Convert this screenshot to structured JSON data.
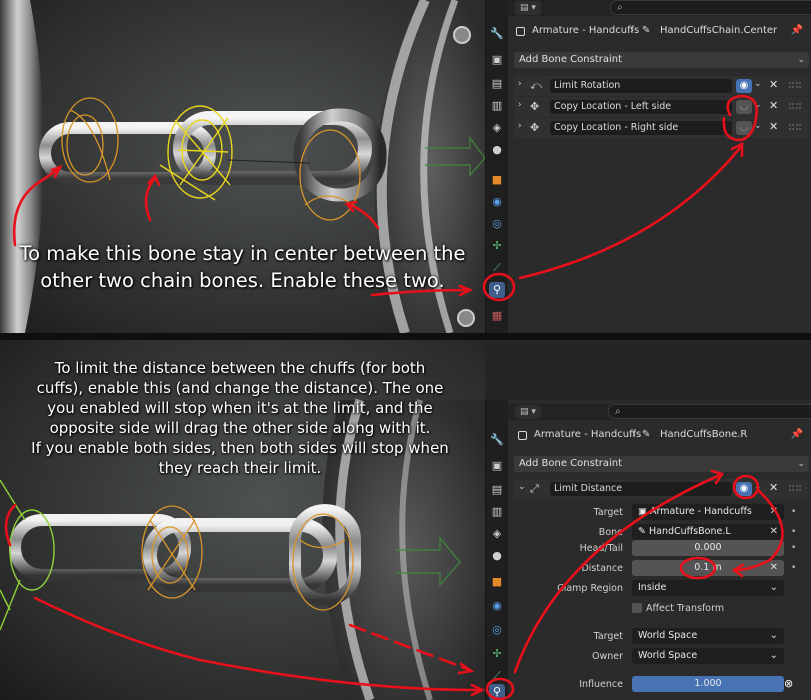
{
  "top": {
    "overlay_text_line1": "To make this bone stay in center between the",
    "overlay_text_line2": "other two chain bones. Enable these two.",
    "panel": {
      "search_placeholder": "",
      "breadcrumb_object": "Armature - Handcuffs",
      "breadcrumb_bone": "HandCuffsChain.Center",
      "add_bone_constraint": "Add Bone Constraint",
      "constraints": [
        {
          "name": "Limit Rotation",
          "enabled": true
        },
        {
          "name": "Copy Location - Left side",
          "enabled": false
        },
        {
          "name": "Copy Location - Right side",
          "enabled": false
        }
      ]
    }
  },
  "bottom": {
    "overlay_lines": [
      "To limit the distance between the chuffs (for both",
      "cuffs), enable this (and change the distance). The one",
      "you enabled will stop when it's at the limit, and the",
      "opposite side will drag the other side along with it.",
      "If you enable both sides, then both sides will stop when",
      "they reach their limit."
    ],
    "panel": {
      "breadcrumb_object": "Armature - Handcuffs",
      "breadcrumb_bone": "HandCuffsBone.R",
      "add_bone_constraint": "Add Bone Constraint",
      "constraint_name": "Limit Distance",
      "constraint_enabled": true,
      "target_label": "Target",
      "target_value": "Armature - Handcuffs",
      "bone_label": "Bone",
      "bone_value": "HandCuffsBone.L",
      "headtail_label": "Head/Tail",
      "headtail_value": "0.000",
      "distance_label": "Distance",
      "distance_value": "0.1 m",
      "clamp_label": "Clamp Region",
      "clamp_value": "Inside",
      "affect_transform_label": "Affect Transform",
      "target_space_label": "Target",
      "target_space_value": "World Space",
      "owner_space_label": "Owner",
      "owner_space_value": "World Space",
      "influence_label": "Influence",
      "influence_value": "1.000"
    }
  },
  "colors": {
    "annotation_red": "#e8101a",
    "blender_blue": "#4772b3",
    "bone_yellow": "#e8d61e",
    "bone_orange": "#d9952a",
    "bone_green": "#8fd23a"
  },
  "icons": [
    "wrench-icon",
    "render-icon",
    "output-icon",
    "view-layer-icon",
    "scene-icon",
    "world-icon",
    "object-icon",
    "modifier-icon",
    "particles-icon",
    "physics-icon",
    "bone-icon",
    "bone-constraint-icon",
    "texture-icon",
    "eye-icon",
    "close-icon",
    "chevron-down-icon",
    "pin-icon",
    "search-icon"
  ]
}
